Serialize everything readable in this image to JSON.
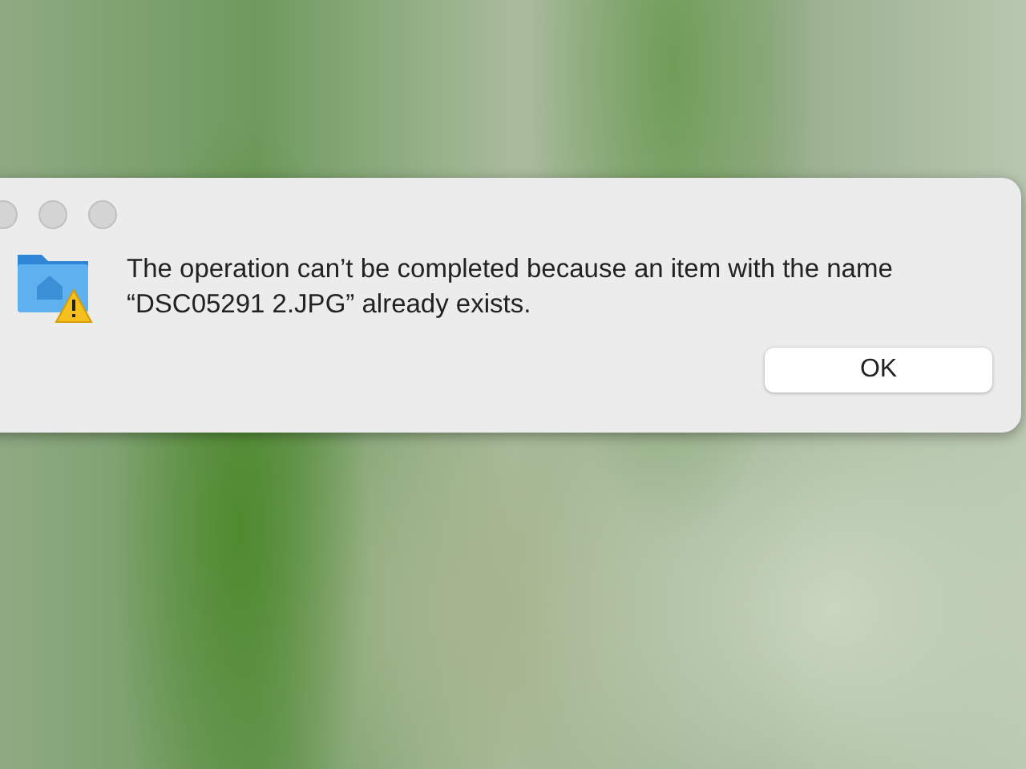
{
  "dialog": {
    "message": "The operation can’t be completed because an item with the name “DSC05291 2.JPG” already exists.",
    "buttons": [
      "OK"
    ]
  }
}
